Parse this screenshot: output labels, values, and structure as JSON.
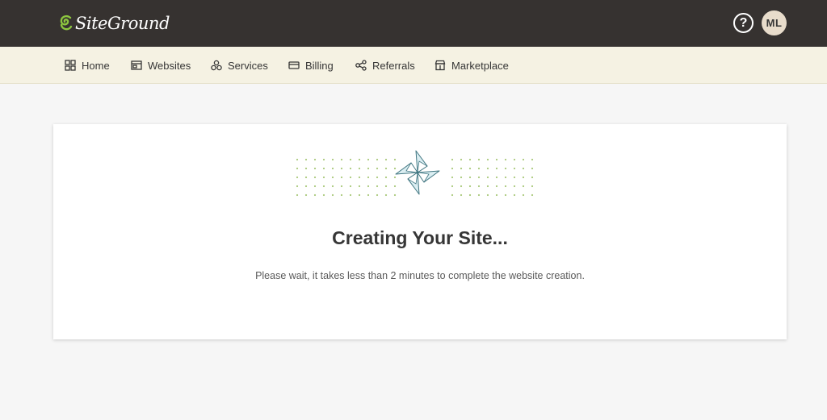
{
  "header": {
    "logo_text": "SiteGround",
    "help_icon": "question-circle-icon",
    "help_glyph": "?",
    "avatar_initials": "ML"
  },
  "nav": {
    "items": [
      {
        "label": "Home",
        "icon": "grid-icon"
      },
      {
        "label": "Websites",
        "icon": "browser-window-icon"
      },
      {
        "label": "Services",
        "icon": "services-icon"
      },
      {
        "label": "Billing",
        "icon": "credit-card-icon"
      },
      {
        "label": "Referrals",
        "icon": "share-nodes-icon"
      },
      {
        "label": "Marketplace",
        "icon": "storefront-icon"
      }
    ]
  },
  "main": {
    "illustration": "pinwheel-icon",
    "title": "Creating Your Site...",
    "subtitle": "Please wait, it takes less than 2 minutes to complete the website creation."
  },
  "colors": {
    "topbar": "#363230",
    "navbar": "#f5f2e3",
    "dots": "#a9c97a",
    "pinwheel_fill": "#dbeef2",
    "pinwheel_stroke": "#3f7580",
    "logo_accent": "#8dc63f"
  }
}
